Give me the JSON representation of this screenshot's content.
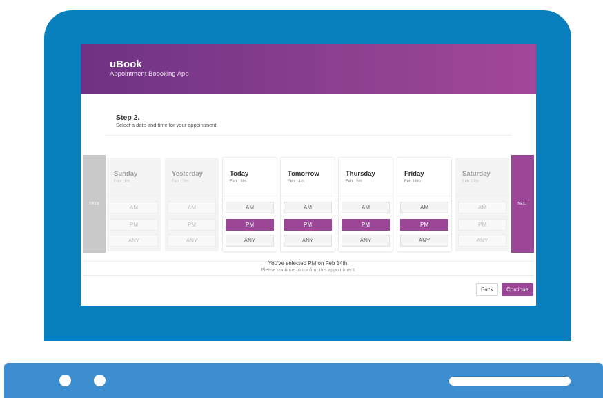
{
  "app": {
    "title": "uBook",
    "subtitle": "Appointment Boooking App"
  },
  "step": {
    "title": "Step 2.",
    "subtitle": "Select a date and time for your appointment"
  },
  "nav": {
    "prev_label": "PREV",
    "next_label": "NEXT"
  },
  "days": [
    {
      "name": "Sunday",
      "date": "Feb 11th",
      "state": "past",
      "slots": [
        "AM",
        "PM",
        "ANY"
      ],
      "selected_slot": null
    },
    {
      "name": "Yesterday",
      "date": "Feb 12th",
      "state": "past",
      "slots": [
        "AM",
        "PM",
        "ANY"
      ],
      "selected_slot": null
    },
    {
      "name": "Today",
      "date": "Feb 13th",
      "state": "available",
      "slots": [
        "AM",
        "PM",
        "ANY"
      ],
      "selected_slot": "PM"
    },
    {
      "name": "Tomorrow",
      "date": "Feb 14th",
      "state": "available",
      "slots": [
        "AM",
        "PM",
        "ANY"
      ],
      "selected_slot": "PM"
    },
    {
      "name": "Thursday",
      "date": "Feb 15th",
      "state": "available",
      "slots": [
        "AM",
        "PM",
        "ANY"
      ],
      "selected_slot": "PM"
    },
    {
      "name": "Friday",
      "date": "Feb 16th",
      "state": "available",
      "slots": [
        "AM",
        "PM",
        "ANY"
      ],
      "selected_slot": "PM"
    },
    {
      "name": "Saturday",
      "date": "Feb 17th",
      "state": "past",
      "slots": [
        "AM",
        "PM",
        "ANY"
      ],
      "selected_slot": null
    }
  ],
  "confirmation": {
    "message": "You've selected PM on Feb 14th.",
    "hint": "Please continue to confirm this appointment."
  },
  "buttons": {
    "back": "Back",
    "continue": "Continue"
  },
  "colors": {
    "device_frame": "#0a7fbd",
    "device_base": "#3d8ed0",
    "accent": "#9b4697",
    "header_gradient_start": "#6f3283",
    "header_gradient_end": "#a3479b"
  }
}
